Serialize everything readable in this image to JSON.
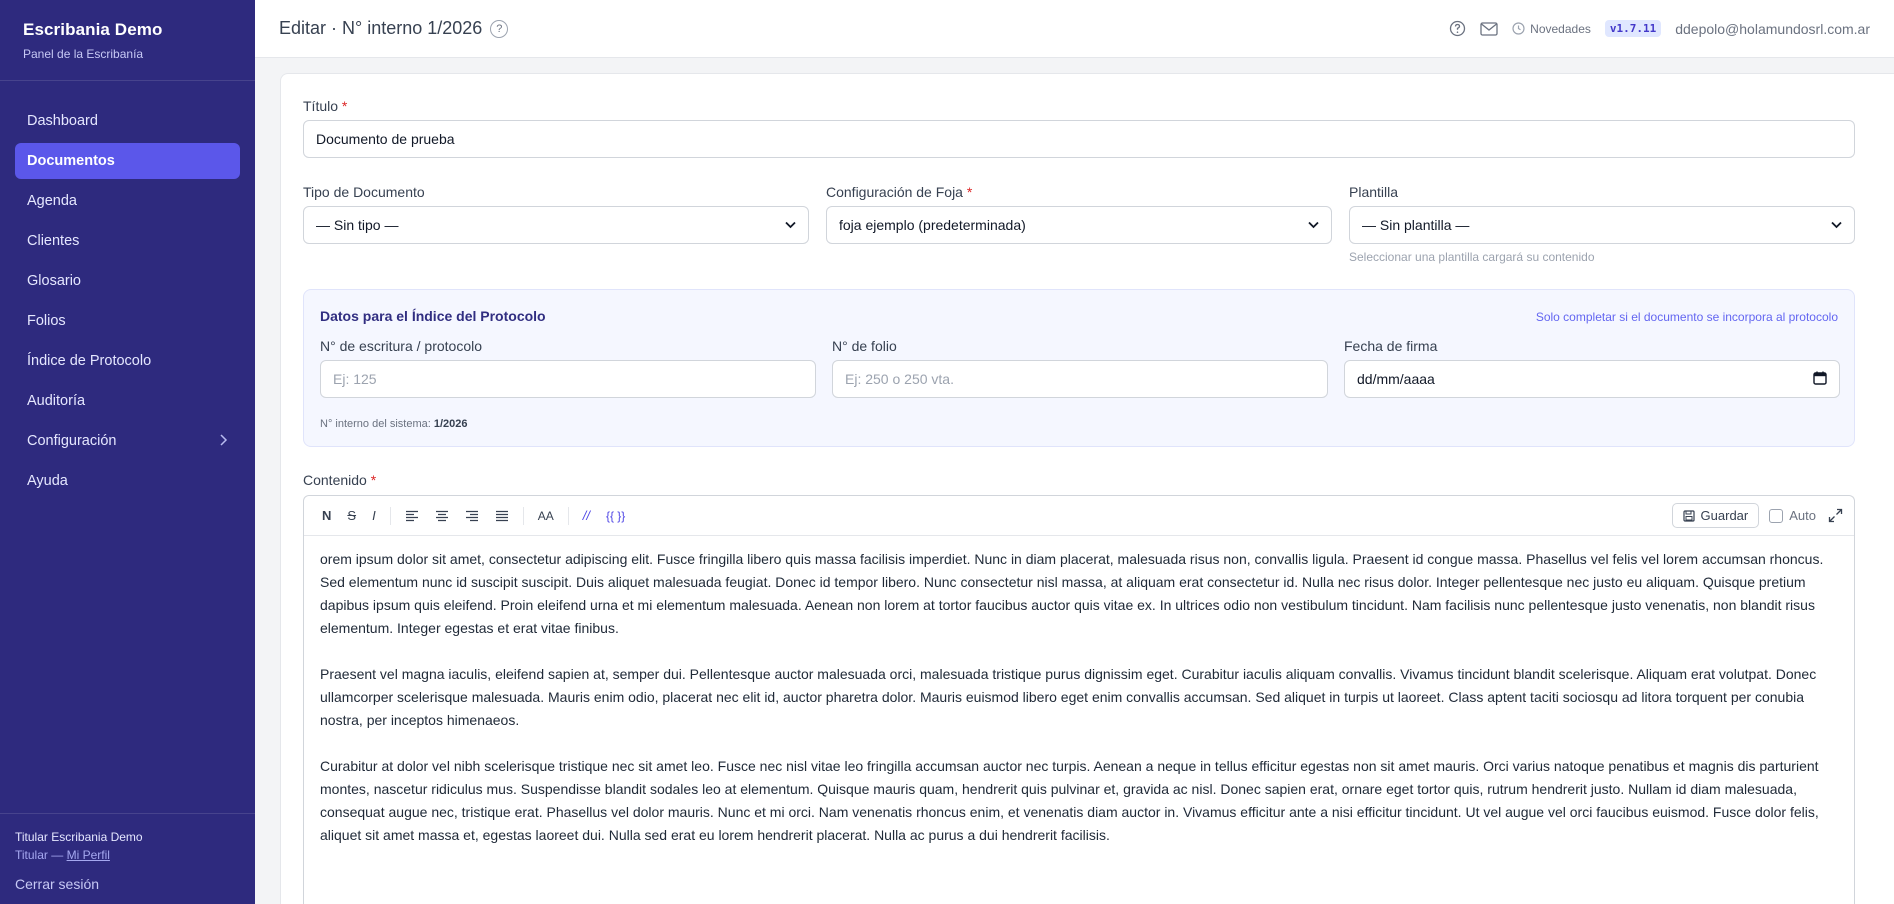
{
  "sidebar": {
    "brand_title": "Escribania Demo",
    "brand_subtitle": "Panel de la Escribanía",
    "items": [
      {
        "label": "Dashboard"
      },
      {
        "label": "Documentos"
      },
      {
        "label": "Agenda"
      },
      {
        "label": "Clientes"
      },
      {
        "label": "Glosario"
      },
      {
        "label": "Folios"
      },
      {
        "label": "Índice de Protocolo"
      },
      {
        "label": "Auditoría"
      },
      {
        "label": "Configuración"
      },
      {
        "label": "Ayuda"
      }
    ],
    "footer_name": "Titular Escribania Demo",
    "footer_role": "Titular —",
    "footer_profile_link": "Mi Perfil",
    "logout": "Cerrar sesión"
  },
  "header": {
    "title": "Editar · N° interno 1/2026",
    "help_glyph": "?",
    "news_label": "Novedades",
    "version": "v1.7.11",
    "user_email": "ddepolo@holamundosrl.com.ar"
  },
  "form": {
    "title_label": "Título",
    "title_value": "Documento de prueba",
    "required_mark": "*",
    "doc_type_label": "Tipo de Documento",
    "doc_type_value": "— Sin tipo —",
    "foja_label": "Configuración de Foja",
    "foja_value": "foja ejemplo (predeterminada)",
    "template_label": "Plantilla",
    "template_value": "— Sin plantilla —",
    "template_hint": "Seleccionar una plantilla cargará su contenido"
  },
  "index": {
    "title": "Datos para el Índice del Protocolo",
    "note": "Solo completar si el documento se incorpora al protocolo",
    "deed_label": "N° de escritura / protocolo",
    "deed_placeholder": "Ej: 125",
    "folio_label": "N° de folio",
    "folio_placeholder": "Ej: 250 o 250 vta.",
    "date_label": "Fecha de firma",
    "date_value": "dd/mm/aaaa",
    "system_label": "N° interno del sistema:",
    "system_value": "1/2026"
  },
  "editor": {
    "label": "Contenido",
    "toolbar": {
      "bold": "N",
      "strike": "S",
      "italic": "I",
      "case": "AA",
      "comment": "//",
      "vars": "{{ }}",
      "save": "Guardar",
      "auto": "Auto"
    },
    "paragraphs": [
      "orem ipsum dolor sit amet, consectetur adipiscing elit. Fusce fringilla libero quis massa facilisis imperdiet. Nunc in diam placerat, malesuada risus non, convallis ligula. Praesent id congue massa. Phasellus vel felis vel lorem accumsan rhoncus. Sed elementum nunc id suscipit suscipit. Duis aliquet malesuada feugiat. Donec id tempor libero. Nunc consectetur nisl massa, at aliquam erat consectetur id. Nulla nec risus dolor. Integer pellentesque nec justo eu aliquam. Quisque pretium dapibus ipsum quis eleifend. Proin eleifend urna et mi elementum malesuada. Aenean non lorem at tortor faucibus auctor quis vitae ex. In ultrices odio non vestibulum tincidunt. Nam facilisis nunc pellentesque justo venenatis, non blandit risus elementum. Integer egestas et erat vitae finibus.",
      "Praesent vel magna iaculis, eleifend sapien at, semper dui. Pellentesque auctor malesuada orci, malesuada tristique purus dignissim eget. Curabitur iaculis aliquam convallis. Vivamus tincidunt blandit scelerisque. Aliquam erat volutpat. Donec ullamcorper scelerisque malesuada. Mauris enim odio, placerat nec elit id, auctor pharetra dolor. Mauris euismod libero eget enim convallis accumsan. Sed aliquet in turpis ut laoreet. Class aptent taciti sociosqu ad litora torquent per conubia nostra, per inceptos himenaeos.",
      "Curabitur at dolor vel nibh scelerisque tristique nec sit amet leo. Fusce nec nisl vitae leo fringilla accumsan auctor nec turpis. Aenean a neque in tellus efficitur egestas non sit amet mauris. Orci varius natoque penatibus et magnis dis parturient montes, nascetur ridiculus mus. Suspendisse blandit sodales leo at elementum. Quisque mauris quam, hendrerit quis pulvinar et, gravida ac nisl. Donec sapien erat, ornare eget tortor quis, rutrum hendrerit justo. Nullam id diam malesuada, consequat augue nec, tristique erat. Phasellus vel dolor mauris. Nunc et mi orci. Nam venenatis rhoncus enim, et venenatis diam auctor in. Vivamus efficitur ante a nisi efficitur tincidunt. Ut vel augue vel orci faucibus euismod. Fusce dolor felis, aliquet sit amet massa et, egestas laoreet dui. Nulla sed erat eu lorem hendrerit placerat. Nulla ac purus a dui hendrerit facilisis."
    ]
  },
  "colors": {
    "sidebar_bg": "#2e2a7e",
    "active_item": "#5b57ea",
    "required": "#dc2626",
    "accent": "#4f46e5"
  }
}
